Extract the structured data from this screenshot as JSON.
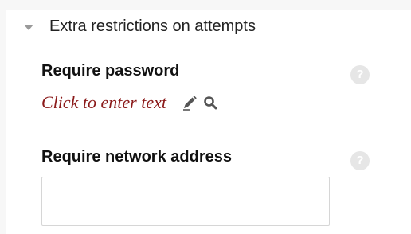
{
  "section": {
    "title": "Extra restrictions on attempts"
  },
  "password": {
    "label": "Require password",
    "inplace_text": "Click to enter text",
    "help_icon": "?"
  },
  "network": {
    "label": "Require network address",
    "help_icon": "?",
    "value": "",
    "placeholder": ""
  },
  "icons": {
    "collapse": "chevron-down-icon",
    "edit": "pencil-icon",
    "preview": "search-icon",
    "help": "question-circle-icon"
  },
  "colors": {
    "inplace_text": "#8b1a1a",
    "help_icon_bg": "#e6e6e6",
    "caret": "#9a9a9a"
  }
}
